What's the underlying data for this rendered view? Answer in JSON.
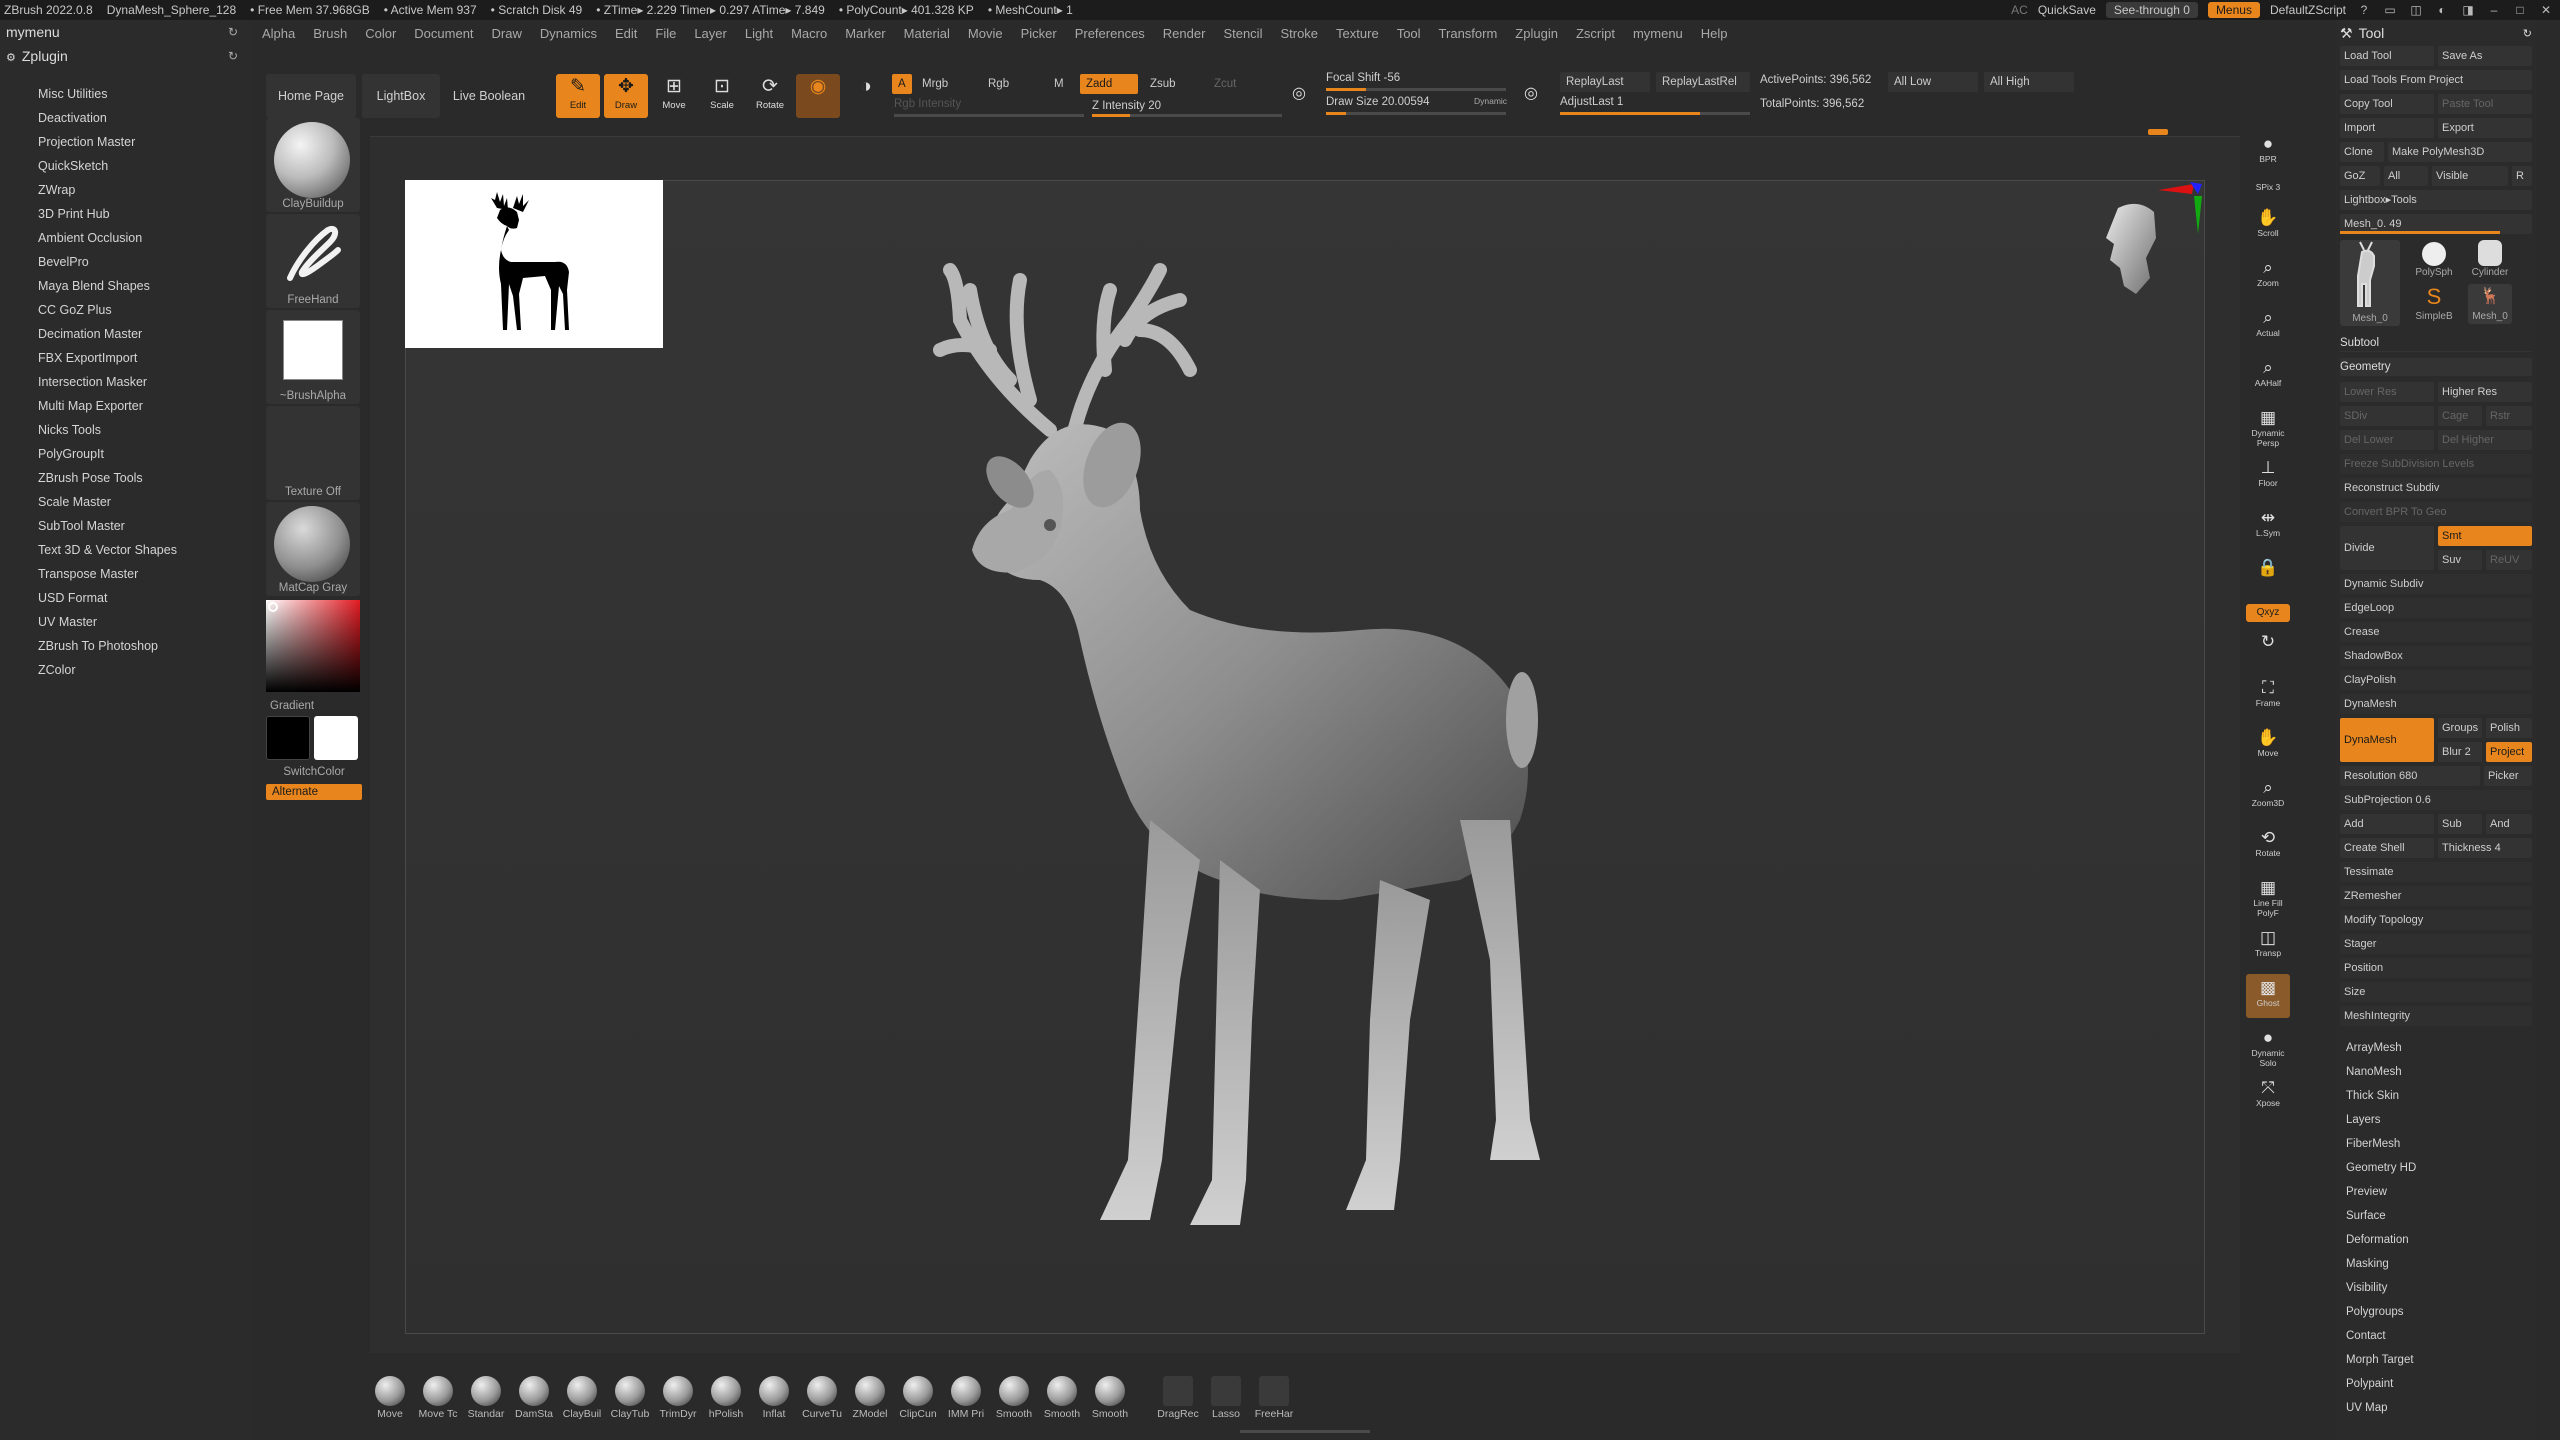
{
  "titlebar": {
    "app": "ZBrush 2022.0.8",
    "items": [
      "DynaMesh_Sphere_128",
      "• Free Mem 37.968GB",
      "• Active Mem 937",
      "• Scratch Disk 49",
      "• ZTime▸ 2.229 Timer▸ 0.297 ATime▸ 7.849",
      "• PolyCount▸ 401.328 KP",
      "• MeshCount▸ 1"
    ],
    "ac": "AC",
    "quicksave": "QuickSave",
    "seethrough": "See-through  0",
    "menus": "Menus",
    "zscript": "DefaultZScript"
  },
  "menubar": [
    "Alpha",
    "Brush",
    "Color",
    "Document",
    "Draw",
    "Dynamics",
    "Edit",
    "File",
    "Layer",
    "Light",
    "Macro",
    "Marker",
    "Material",
    "Movie",
    "Picker",
    "Preferences",
    "Render",
    "Stencil",
    "Stroke",
    "Texture",
    "Tool",
    "Transform",
    "Zplugin",
    "Zscript",
    "mymenu",
    "Help"
  ],
  "leftpane": {
    "user_label": "mymenu",
    "plugin_label": "Zplugin",
    "plugins": [
      "Misc Utilities",
      "Deactivation",
      "Projection Master",
      "QuickSketch",
      "ZWrap",
      "3D Print Hub",
      "Ambient Occlusion",
      "BevelPro",
      "Maya Blend Shapes",
      "CC GoZ Plus",
      "Decimation Master",
      "FBX ExportImport",
      "Intersection Masker",
      "Multi Map Exporter",
      "Nicks Tools",
      "PolyGroupIt",
      "ZBrush Pose Tools",
      "Scale Master",
      "SubTool Master",
      "Text 3D & Vector Shapes",
      "Transpose Master",
      "USD Format",
      "UV Master",
      "ZBrush To Photoshop",
      "ZColor"
    ]
  },
  "brushcol": {
    "brush": "ClayBuildup",
    "stroke": "FreeHand",
    "alpha": "~BrushAlpha",
    "texture": "Texture Off",
    "material": "MatCap Gray",
    "gradient": "Gradient",
    "switch": "SwitchColor",
    "alternate": "Alternate"
  },
  "topshelf": {
    "home": "Home Page",
    "lightbox": "LightBox",
    "liveboolean": "Live Boolean",
    "tools": [
      "Edit",
      "Draw",
      "Move",
      "Scale",
      "Rotate"
    ],
    "a": "A",
    "mrgb": "Mrgb",
    "rgb": "Rgb",
    "m": "M",
    "zadd": "Zadd",
    "zsub": "Zsub",
    "zcut": "Zcut",
    "rgb_intensity": "Rgb Intensity",
    "z_intensity": "Z Intensity 20",
    "focal_shift": "Focal Shift -56",
    "draw_size": "Draw Size 20.00594",
    "dynamic": "Dynamic",
    "replaylast": "ReplayLast",
    "replaylastrel": "ReplayLastRel",
    "adjustlast": "AdjustLast 1",
    "activepoints": "ActivePoints: 396,562",
    "totalpoints": "TotalPoints: 396,562",
    "alllow": "All Low",
    "allhigh": "All High",
    "z_intensity_value": 20
  },
  "righttools": [
    "BPR",
    "SPix 3",
    "Scroll",
    "Zoom",
    "Actual",
    "AAHalf",
    "Dynamic Persp",
    "Floor",
    "L.Sym",
    "Qxyz",
    "Frame",
    "Move",
    "Zoom3D",
    "Rotate",
    "Line Fill PolyF",
    "Transp",
    "Ghost",
    "Dynamic Solo",
    "Xpose"
  ],
  "toolpalette": {
    "title": "Tool",
    "rows": [
      [
        "Load Tool",
        "Save As"
      ],
      [
        "Load Tools From Project"
      ],
      [
        "Copy Tool",
        "Paste Tool"
      ],
      [
        "Import",
        "Export"
      ],
      [
        "Clone",
        "Make PolyMesh3D"
      ],
      [
        "GoZ",
        "All",
        "Visible",
        "R"
      ],
      [
        "Lightbox▸Tools"
      ]
    ],
    "mesh_slider": "Mesh_0. 49",
    "mesh_labels": [
      "Mesh_0",
      "PolySph",
      "Cylinder",
      "SimpleB",
      "Mesh_0"
    ],
    "subtool": "Subtool",
    "geometry": "Geometry",
    "geo_items": [
      "Lower Res",
      "Higher Res",
      "SDiv",
      "Cage",
      "Rstr",
      "Del Lower",
      "Del Higher",
      "Freeze SubDivision Levels",
      "Reconstruct Subdiv",
      "Convert BPR To Geo",
      "Divide",
      "Smt",
      "Suv",
      "ReUV",
      "Dynamic Subdiv",
      "EdgeLoop",
      "Crease",
      "ShadowBox",
      "ClayPolish",
      "DynaMesh",
      "DynaMesh",
      "Groups",
      "Polish",
      "Blur 2",
      "Project",
      "Resolution 680",
      "Picker",
      "SubProjection 0.6",
      "Add",
      "Sub",
      "And",
      "Create Shell",
      "Thickness 4",
      "Tessimate",
      "ZRemesher",
      "Modify Topology",
      "Stager",
      "Position",
      "Size",
      "MeshIntegrity"
    ],
    "sections": [
      "ArrayMesh",
      "NanoMesh",
      "Thick Skin",
      "Layers",
      "FiberMesh",
      "Geometry HD",
      "Preview",
      "Surface",
      "Deformation",
      "Masking",
      "Visibility",
      "Polygroups",
      "Contact",
      "Morph Target",
      "Polypaint",
      "UV Map"
    ]
  },
  "brushbar": [
    "Move",
    "Move Tc",
    "Standar",
    "DamSta",
    "ClayBuil",
    "ClayTub",
    "TrimDyr",
    "hPolish",
    "Inflat",
    "CurveTu",
    "ZModel",
    "ClipCun",
    "IMM Pri",
    "Smooth",
    "Smooth",
    "Smooth",
    "DragRec",
    "Lasso",
    "FreeHar"
  ],
  "colors": {
    "accent": "#e8861d",
    "bg": "#2a2a2a",
    "panel": "#2b2b2b"
  }
}
